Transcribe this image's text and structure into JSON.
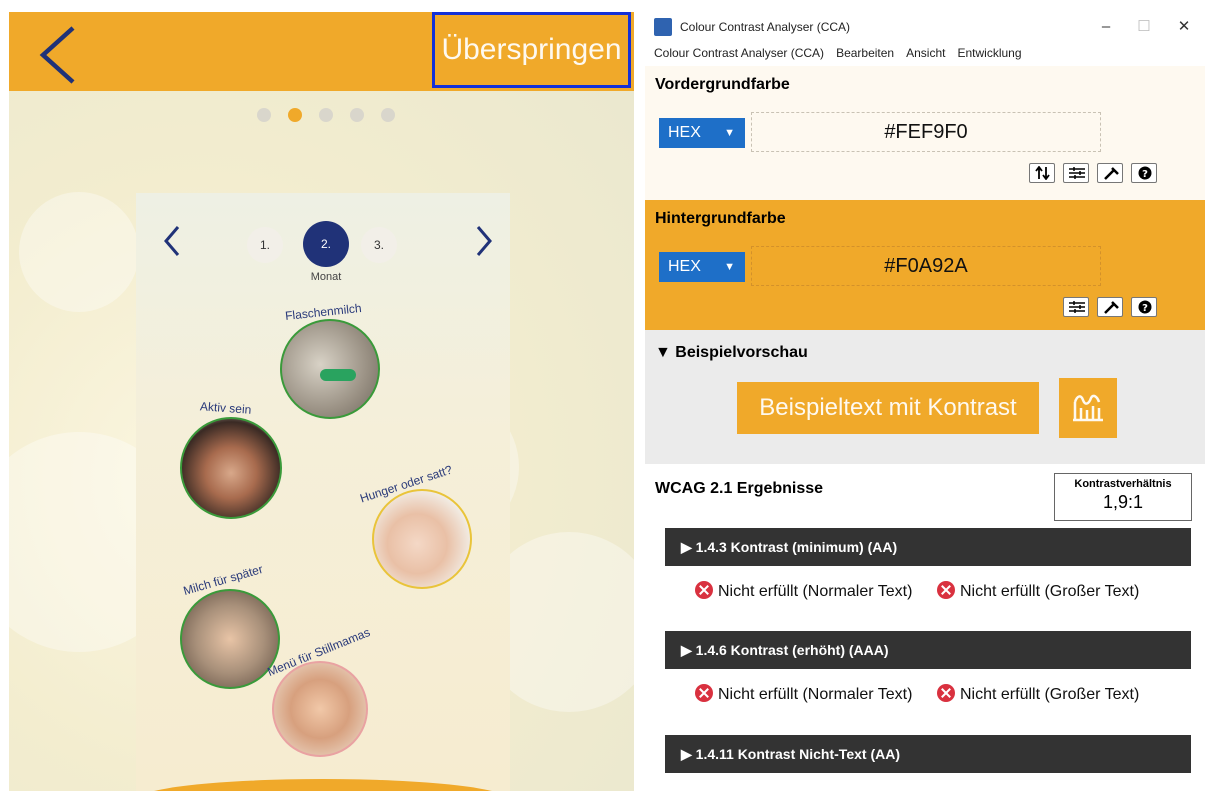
{
  "app": {
    "skip_label": "Überspringen",
    "page_dots": 5,
    "active_dot": 1,
    "months": [
      "1.",
      "2.",
      "3."
    ],
    "active_month": "2.",
    "month_caption": "Monat",
    "topics": [
      "Flaschenmilch",
      "Aktiv sein",
      "Hunger oder satt?",
      "Milch für später",
      "Menü für Stillmamas"
    ],
    "colors": {
      "header": "#f0a92a",
      "skip_text": "#fef9f0",
      "highlight": "#1330d8",
      "month_active": "#203278"
    }
  },
  "cca": {
    "window_title": "Colour Contrast Analyser (CCA)",
    "menu": [
      "Colour Contrast Analyser (CCA)",
      "Bearbeiten",
      "Ansicht",
      "Entwicklung"
    ],
    "foreground": {
      "title": "Vordergrundfarbe",
      "format": "HEX",
      "value": "#FEF9F0"
    },
    "background": {
      "title": "Hintergrundfarbe",
      "format": "HEX",
      "value": "#F0A92A"
    },
    "preview": {
      "title": "▼ Beispielvorschau",
      "sample_text": "Beispieltext mit Kontrast"
    },
    "results": {
      "title": "WCAG 2.1 Ergebnisse",
      "ratio_label": "Kontrastverhältnis",
      "ratio_value": "1,9:1",
      "criteria": [
        {
          "label": "▶ 1.4.3 Kontrast (minimum) (AA)",
          "normal": "Nicht erfüllt (Normaler Text)",
          "large": "Nicht erfüllt (Großer Text)"
        },
        {
          "label": "▶ 1.4.6 Kontrast (erhöht) (AAA)",
          "normal": "Nicht erfüllt (Normaler Text)",
          "large": "Nicht erfüllt (Großer Text)"
        },
        {
          "label": "▶ 1.4.11 Kontrast Nicht-Text (AA)"
        }
      ]
    },
    "colors": {
      "foreground": "#fef9f0",
      "background": "#f0a92a",
      "select": "#1e6fc8",
      "fail": "#d9313f",
      "criterion_bar": "#333333"
    }
  }
}
